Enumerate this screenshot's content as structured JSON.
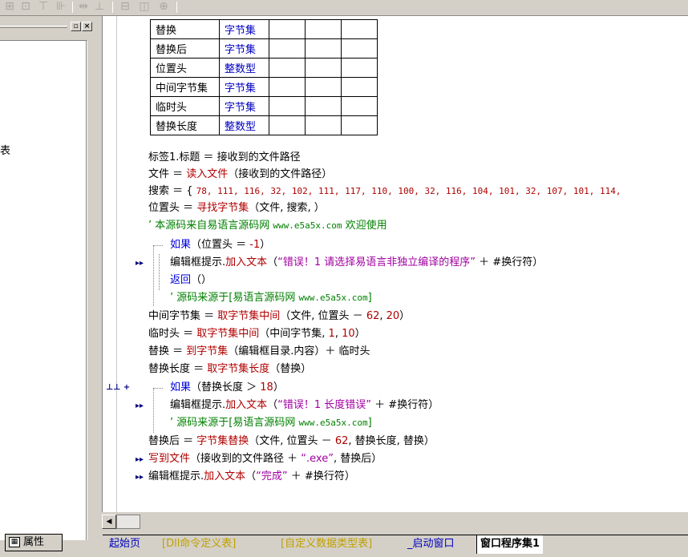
{
  "left_panel": {
    "clipped_text": "表",
    "property_tab": "属性"
  },
  "var_table": [
    {
      "name": "替换",
      "type": "字节集"
    },
    {
      "name": "替换后",
      "type": "字节集"
    },
    {
      "name": "位置头",
      "type": "整数型"
    },
    {
      "name": "中间字节集",
      "type": "字节集"
    },
    {
      "name": "临时头",
      "type": "字节集"
    },
    {
      "name": "替换长度",
      "type": "整数型"
    }
  ],
  "code": {
    "l1": {
      "a": "标签1.标题 ＝ 接收到的文件路径"
    },
    "l2": {
      "a": "文件 ＝ ",
      "b": "读入文件",
      "c": "（接收到的文件路径）"
    },
    "l3": {
      "a": "搜索 ＝ { ",
      "b": "78, 111, 116, 32, 102, 111, 117, 110, 100, 32, 116, 104, 101, 32, 107, 101, 114,"
    },
    "l4": {
      "a": "位置头 ＝ ",
      "b": "寻找字节集",
      "c": "（文件, 搜索, ）"
    },
    "l5": {
      "a": "’ 本源码来自易语言源码网 ",
      "b": "www.e5a5x.com",
      "c": "  欢迎使用"
    },
    "l6": {
      "a": "如果",
      "b": "（位置头 ＝ ",
      "c": "-1",
      "d": "）"
    },
    "l7": {
      "a": "编辑框提示.",
      "b": "加入文本",
      "c": "（",
      "d": "“错误！1 请选择易语言非独立编译的程序”",
      "e": " ＋ #换行符）"
    },
    "l8": {
      "a": "返回",
      "b": "（）"
    },
    "l9": {
      "a": "’ 源码来源于[易语言源码网 ",
      "b": "www.e5a5x.com",
      "c": "]"
    },
    "l10": {
      "a": "中间字节集 ＝ ",
      "b": "取字节集中间",
      "c": "（文件, 位置头 － ",
      "d": "62",
      "e": ", ",
      "f": "20",
      "g": "）"
    },
    "l11": {
      "a": "临时头 ＝ ",
      "b": "取字节集中间",
      "c": "（中间字节集, ",
      "d": "1",
      "e": ", ",
      "f": "10",
      "g": "）"
    },
    "l12": {
      "a": "替换 ＝ ",
      "b": "到字节集",
      "c": "（编辑框目录.内容）＋ 临时头"
    },
    "l13": {
      "a": "替换长度 ＝ ",
      "b": "取字节集长度",
      "c": "（替换）"
    },
    "l14": {
      "a": "如果",
      "b": "（替换长度 ＞ ",
      "c": "18",
      "d": "）"
    },
    "l15": {
      "a": "编辑框提示.",
      "b": "加入文本",
      "c": "（",
      "d": "“错误！1 长度错误”",
      "e": " ＋ #换行符）"
    },
    "l16": {
      "a": "’ 源码来源于[易语言源码网 ",
      "b": "www.e5a5x.com",
      "c": "]"
    },
    "l17": {
      "a": "替换后 ＝ ",
      "b": "字节集替换",
      "c": "（文件, 位置头 － ",
      "d": "62",
      "e": ", 替换长度, 替换）"
    },
    "l18": {
      "a": "写到文件",
      "b": "（接收到的文件路径 ＋ ",
      "c": "“.exe”",
      "d": ", 替换后）"
    },
    "l19": {
      "a": "编辑框提示.",
      "b": "加入文本",
      "c": "（",
      "d": "“完成”",
      "e": " ＋ #换行符）"
    }
  },
  "gutter": {
    "arrow": "▸▸",
    "plus_marker": "⊥⊥ +"
  },
  "tabs": [
    {
      "label": "起始页"
    },
    {
      "label": "[Dll命令定义表]"
    },
    {
      "label": "[自定义数据类型表]"
    },
    {
      "label": "_启动窗口"
    },
    {
      "label": "窗口程序集1"
    }
  ],
  "colors": {
    "keyword": "#0000a0",
    "function": "#b00000",
    "string": "#a000a0",
    "comment": "#008000",
    "type": "#0000c0"
  }
}
